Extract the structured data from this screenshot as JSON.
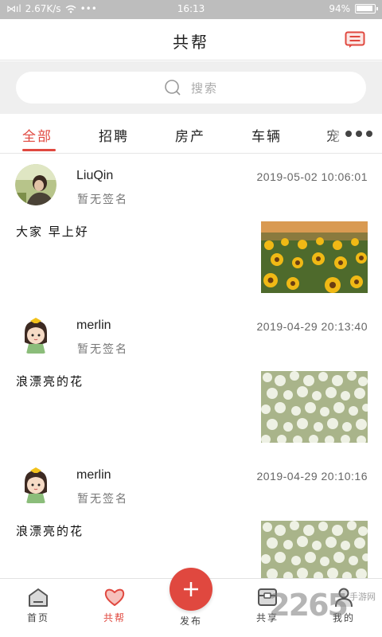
{
  "status_bar": {
    "signal_text": "⋈ıl",
    "speed": "2.67K/s",
    "wifi_icon": "wifi-icon",
    "dots": "•••",
    "time": "16:13",
    "battery": "94%"
  },
  "header": {
    "title": "共帮",
    "message_icon": "message-icon"
  },
  "search": {
    "placeholder": "搜索",
    "icon": "search-icon"
  },
  "tabs": [
    {
      "label": "全部",
      "active": true
    },
    {
      "label": "招聘",
      "active": false
    },
    {
      "label": "房产",
      "active": false
    },
    {
      "label": "车辆",
      "active": false
    },
    {
      "label": "宠",
      "active": false
    }
  ],
  "posts": [
    {
      "user": "LiuQin",
      "signature": "暂无签名",
      "time": "2019-05-02 10:06:01",
      "content": "大家 早上好",
      "photo": "sunflowers"
    },
    {
      "user": "merlin",
      "signature": "暂无签名",
      "time": "2019-04-29 20:13:40",
      "content": "浪漂亮的花",
      "photo": "jasmine"
    },
    {
      "user": "merlin",
      "signature": "暂无签名",
      "time": "2019-04-29 20:10:16",
      "content": "浪漂亮的花",
      "photo": "jasmine"
    }
  ],
  "bottom_nav": {
    "items": [
      {
        "label": "首页",
        "icon": "home-icon",
        "active": false
      },
      {
        "label": "共帮",
        "icon": "heart-icon",
        "active": true
      },
      {
        "label": "发布",
        "icon": "plus-icon",
        "active": false
      },
      {
        "label": "共享",
        "icon": "share-box-icon",
        "active": false
      },
      {
        "label": "我的",
        "icon": "person-icon",
        "active": false
      }
    ]
  },
  "watermark": {
    "number": "2265",
    "text": "手游网"
  },
  "colors": {
    "accent": "#e0483f",
    "search_bg": "#efefef",
    "status_bar": "#bdbdbd"
  }
}
